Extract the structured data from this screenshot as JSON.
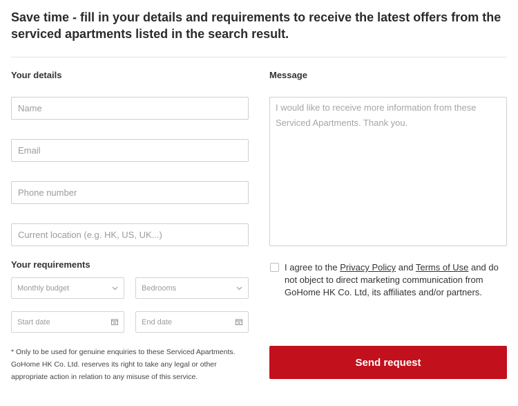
{
  "header": {
    "title": "Save time - fill in your details and requirements to receive the latest offers from the serviced apartments listed in the search result."
  },
  "details": {
    "label": "Your details",
    "name_placeholder": "Name",
    "email_placeholder": "Email",
    "phone_placeholder": "Phone number",
    "location_placeholder": "Current location (e.g. HK, US, UK...)"
  },
  "requirements": {
    "label": "Your requirements",
    "budget_value": "Monthly budget",
    "bedrooms_value": "Bedrooms",
    "start_date_placeholder": "Start date",
    "end_date_placeholder": "End date"
  },
  "message": {
    "label": "Message",
    "placeholder": "I would like to receive more information from these Serviced Apartments. Thank you."
  },
  "consent": {
    "text_before": "I agree to the ",
    "privacy_link": "Privacy Policy",
    "text_and": " and ",
    "terms_link": "Terms of Use",
    "text_after": " and do not object to direct marketing communication from GoHome HK Co. Ltd, its affiliates and/or partners."
  },
  "disclaimer": "* Only to be used for genuine enquiries to these Serviced Apartments. GoHome HK Co. Ltd. reserves its right to take any legal or other appropriate action in relation to any misuse of this service.",
  "send_button_label": "Send request",
  "icons": {
    "dropdown": "chevron-down-icon",
    "date": "calendar-icon"
  },
  "colors": {
    "primary": "#c2101d",
    "border": "#cfcfcf",
    "placeholder": "#9b9b9b"
  }
}
